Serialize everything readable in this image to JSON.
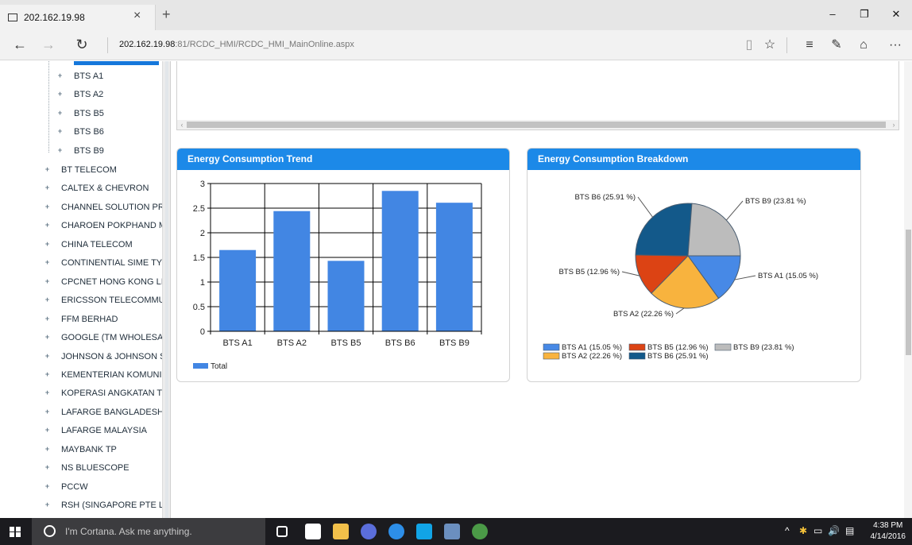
{
  "browser": {
    "tab_title": "202.162.19.98",
    "tab_close": "×",
    "new_tab": "+",
    "window_minimize": "–",
    "window_maximize": "❐",
    "window_close": "✕",
    "back": "←",
    "forward": "→",
    "refresh": "↻",
    "url_host": "202.162.19.98",
    "url_rest": ":81/RCDC_HMI/RCDC_HMI_MainOnline.aspx",
    "reading_view": "▯",
    "favorite": "☆",
    "hub": "≡",
    "web_note": "✎",
    "share": "⌂",
    "more": "···"
  },
  "tree": {
    "sub_items": [
      "BTS A1",
      "BTS A2",
      "BTS B5",
      "BTS B6",
      "BTS B9"
    ],
    "items": [
      "BT TELECOM",
      "CALTEX & CHEVRON",
      "CHANNEL SOLUTION PR",
      "CHAROEN POKPHAND M/",
      "CHINA TELECOM",
      "CONTINENTIAL SIME TYI",
      "CPCNET HONG KONG LII",
      "ERICSSON TELECOMMUI",
      "FFM BERHAD",
      "GOOGLE (TM WHOLESAL",
      "JOHNSON & JOHNSON S",
      "KEMENTERIAN KOMUNIK",
      "KOPERASI ANGKATAN TI",
      "LAFARGE BANGLADESH",
      "LAFARGE MALAYSIA",
      "MAYBANK TP",
      "NS BLUESCOPE",
      "PCCW",
      "RSH (SINGAPORE PTE LT"
    ]
  },
  "panels": {
    "trend_title": "Energy Consumption Trend",
    "breakdown_title": "Energy Consumption Breakdown"
  },
  "chart_data": [
    {
      "type": "bar",
      "title": "Energy Consumption Trend",
      "categories": [
        "BTS A1",
        "BTS A2",
        "BTS B5",
        "BTS B6",
        "BTS B9"
      ],
      "series": [
        {
          "name": "Total",
          "values": [
            1.65,
            2.44,
            1.43,
            2.85,
            2.61
          ],
          "color": "#4286e3"
        }
      ],
      "ylim": [
        0,
        3
      ],
      "yticks": [
        "0",
        "0.5",
        "1",
        "1.5",
        "2",
        "2.5",
        "3"
      ],
      "ytick_values": [
        0,
        0.5,
        1,
        1.5,
        2,
        2.5,
        3
      ],
      "grid": true,
      "legend": "bottom-left"
    },
    {
      "type": "pie",
      "title": "Energy Consumption Breakdown",
      "slices": [
        {
          "name": "BTS A1",
          "value": 15.05,
          "label": "BTS A1 (15.05 %)",
          "color": "#4789e6"
        },
        {
          "name": "BTS A2",
          "value": 22.26,
          "label": "BTS A2 (22.26 %)",
          "color": "#f8b33e"
        },
        {
          "name": "BTS B5",
          "value": 12.96,
          "label": "BTS B5 (12.96 %)",
          "color": "#dc4314"
        },
        {
          "name": "BTS B6",
          "value": 25.91,
          "label": "BTS B6 (25.91 %)",
          "color": "#13598a"
        },
        {
          "name": "BTS B9",
          "value": 23.81,
          "label": "BTS B9 (23.81 %)",
          "color": "#bcbcbc"
        }
      ],
      "legend": "bottom"
    }
  ],
  "taskbar": {
    "cortana_placeholder": "I'm Cortana. Ask me anything.",
    "time": "4:38 PM",
    "date": "4/14/2016",
    "tray_chevron": "^",
    "volume": "🔊"
  }
}
